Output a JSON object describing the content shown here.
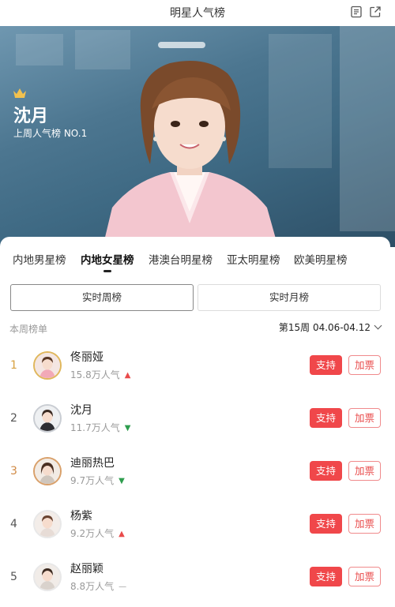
{
  "header": {
    "title": "明星人气榜",
    "icons": [
      "document-icon",
      "share-out-icon"
    ]
  },
  "hero": {
    "crown_icon": "crown-icon",
    "name": "沈月",
    "subtitle": "上周人气榜 NO.1"
  },
  "tabs": [
    {
      "label": "内地男星榜",
      "active": false
    },
    {
      "label": "内地女星榜",
      "active": true
    },
    {
      "label": "港澳台明星榜",
      "active": false
    },
    {
      "label": "亚太明星榜",
      "active": false
    },
    {
      "label": "欧美明星榜",
      "active": false
    }
  ],
  "segments": [
    {
      "label": "实时周榜",
      "active": true
    },
    {
      "label": "实时月榜",
      "active": false
    }
  ],
  "meta": {
    "left": "本周榜单",
    "right": "第15周 04.06-04.12"
  },
  "buttons": {
    "support": "支持",
    "vote": "加票"
  },
  "colors": {
    "accent_red": "#f0474a",
    "gold": "#d7a03f",
    "trend_up": "#e94b4b",
    "trend_down": "#2e9d4e"
  },
  "ranking": [
    {
      "rank": "1",
      "name": "佟丽娅",
      "votes": "15.8万人气",
      "trend": "up"
    },
    {
      "rank": "2",
      "name": "沈月",
      "votes": "11.7万人气",
      "trend": "down"
    },
    {
      "rank": "3",
      "name": "迪丽热巴",
      "votes": "9.7万人气",
      "trend": "down"
    },
    {
      "rank": "4",
      "name": "杨紫",
      "votes": "9.2万人气",
      "trend": "up"
    },
    {
      "rank": "5",
      "name": "赵丽颖",
      "votes": "8.8万人气",
      "trend": "flat"
    }
  ]
}
